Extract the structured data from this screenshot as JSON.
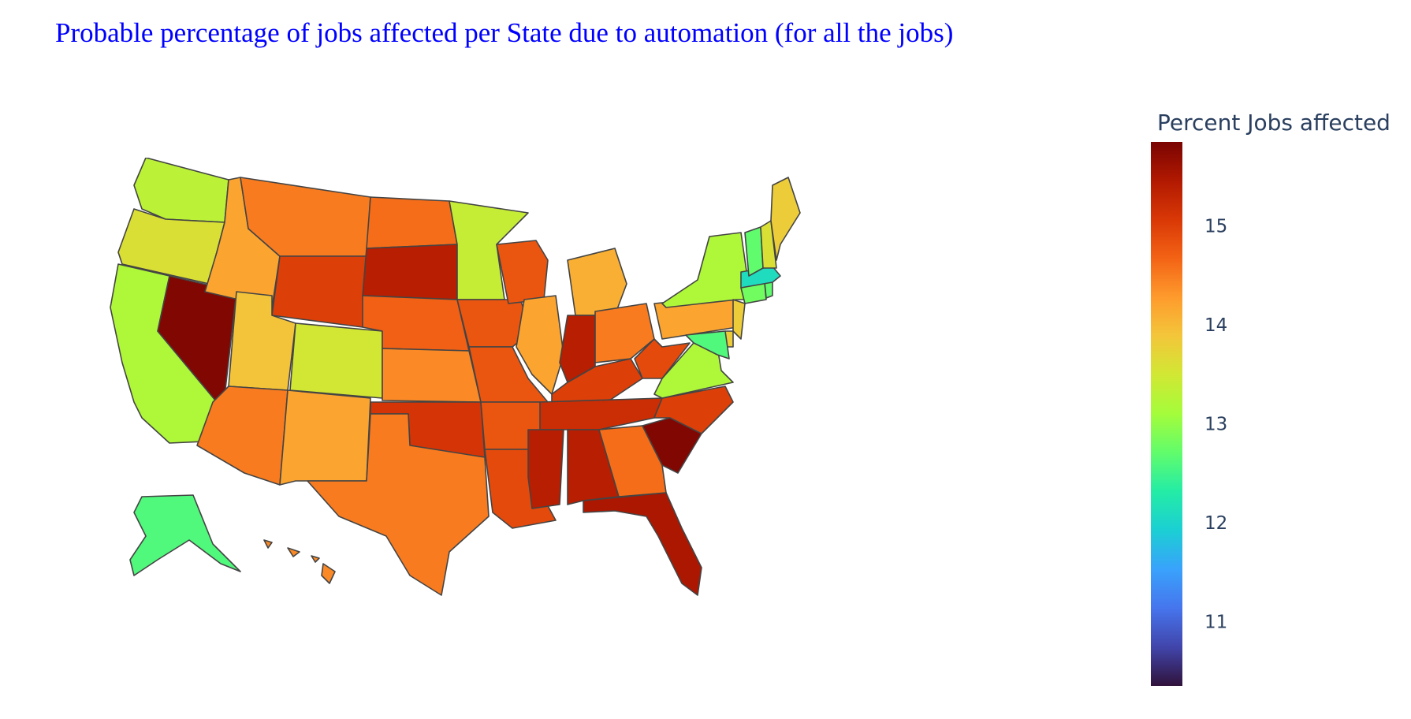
{
  "title": "Probable percentage of jobs affected per State due to automation (for all the jobs)",
  "chart_data": {
    "type": "choropleth",
    "title": "Probable percentage of jobs affected per State due to automation (for all the jobs)",
    "colorbar": {
      "title": "Percent Jobs affected",
      "range": [
        10.35,
        15.85
      ],
      "ticks": [
        11,
        12,
        13,
        14,
        15
      ],
      "colorscale": "Turbo",
      "colors": [
        "#30123b",
        "#4145ab",
        "#4675ed",
        "#39a2fc",
        "#1bcfd4",
        "#24eca6",
        "#61fc6c",
        "#a4fc3b",
        "#d1e834",
        "#f3c63a",
        "#fe9b2d",
        "#f36315",
        "#d93806",
        "#b11901",
        "#7a0402"
      ]
    },
    "states": [
      {
        "code": "WA",
        "value": 13.3
      },
      {
        "code": "OR",
        "value": 13.6
      },
      {
        "code": "CA",
        "value": 13.2
      },
      {
        "code": "NV",
        "value": 15.8
      },
      {
        "code": "ID",
        "value": 14.2
      },
      {
        "code": "MT",
        "value": 14.5
      },
      {
        "code": "WY",
        "value": 15.0
      },
      {
        "code": "UT",
        "value": 13.9
      },
      {
        "code": "CO",
        "value": 13.5
      },
      {
        "code": "AZ",
        "value": 14.5
      },
      {
        "code": "NM",
        "value": 14.2
      },
      {
        "code": "ND",
        "value": 14.6
      },
      {
        "code": "SD",
        "value": 15.4
      },
      {
        "code": "NE",
        "value": 14.7
      },
      {
        "code": "KS",
        "value": 14.4
      },
      {
        "code": "OK",
        "value": 15.1
      },
      {
        "code": "TX",
        "value": 14.5
      },
      {
        "code": "MN",
        "value": 13.4
      },
      {
        "code": "IA",
        "value": 14.8
      },
      {
        "code": "MO",
        "value": 14.8
      },
      {
        "code": "AR",
        "value": 14.8
      },
      {
        "code": "LA",
        "value": 14.9
      },
      {
        "code": "WI",
        "value": 14.8
      },
      {
        "code": "IL",
        "value": 14.2
      },
      {
        "code": "MI",
        "value": 14.1
      },
      {
        "code": "IN",
        "value": 15.4
      },
      {
        "code": "OH",
        "value": 14.5
      },
      {
        "code": "KY",
        "value": 15.0
      },
      {
        "code": "TN",
        "value": 15.2
      },
      {
        "code": "MS",
        "value": 15.4
      },
      {
        "code": "AL",
        "value": 15.4
      },
      {
        "code": "GA",
        "value": 14.6
      },
      {
        "code": "FL",
        "value": 15.5
      },
      {
        "code": "SC",
        "value": 15.8
      },
      {
        "code": "NC",
        "value": 15.0
      },
      {
        "code": "VA",
        "value": 13.2
      },
      {
        "code": "WV",
        "value": 14.9
      },
      {
        "code": "PA",
        "value": 14.2
      },
      {
        "code": "NY",
        "value": 13.2
      },
      {
        "code": "NJ",
        "value": 13.8
      },
      {
        "code": "DE",
        "value": 13.8
      },
      {
        "code": "MD",
        "value": 12.6
      },
      {
        "code": "CT",
        "value": 12.8
      },
      {
        "code": "RI",
        "value": 12.7
      },
      {
        "code": "MA",
        "value": 12.1
      },
      {
        "code": "VT",
        "value": 12.7
      },
      {
        "code": "NH",
        "value": 13.6
      },
      {
        "code": "ME",
        "value": 13.8
      },
      {
        "code": "AK",
        "value": 12.6
      },
      {
        "code": "HI",
        "value": 14.4
      }
    ]
  }
}
